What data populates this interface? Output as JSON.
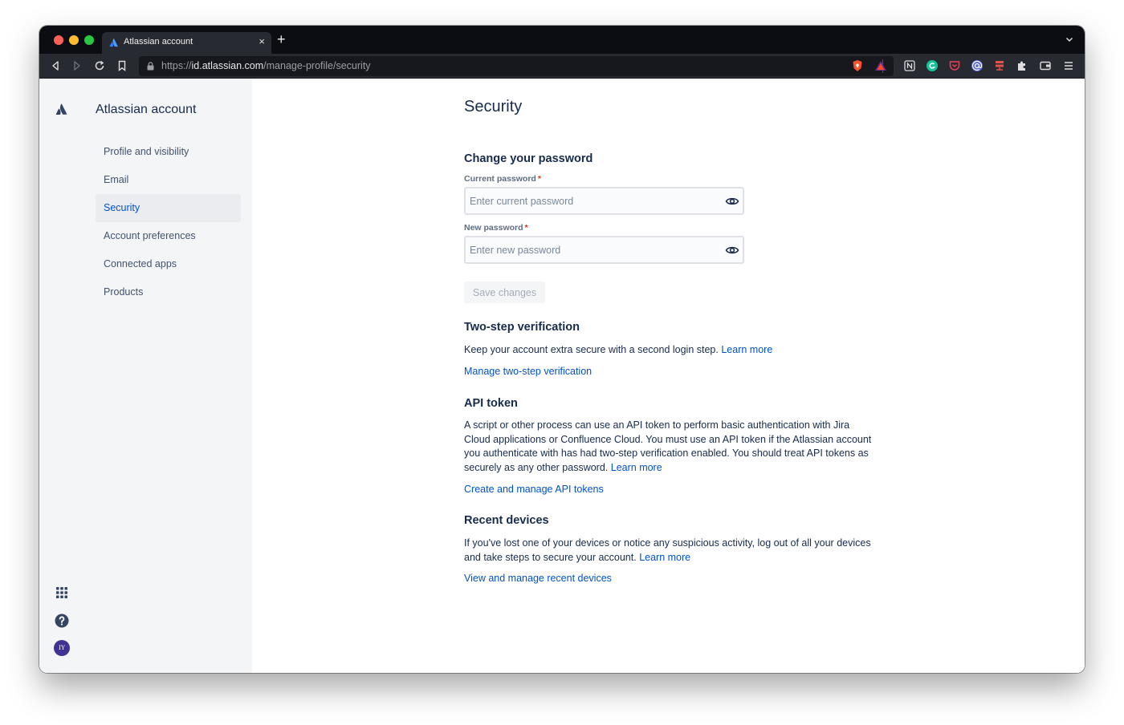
{
  "browser": {
    "tab_title": "Atlassian account",
    "tab_close": "×",
    "new_tab": "+",
    "url_scheme": "https://",
    "url_host": "id.atlassian.com",
    "url_path": "/manage-profile/security"
  },
  "sidebar": {
    "brand": "Atlassian account",
    "items": [
      {
        "label": "Profile and visibility"
      },
      {
        "label": "Email"
      },
      {
        "label": "Security",
        "active": true
      },
      {
        "label": "Account preferences"
      },
      {
        "label": "Connected apps"
      },
      {
        "label": "Products"
      }
    ],
    "avatar_initials": "IY"
  },
  "main": {
    "title": "Security",
    "password": {
      "heading": "Change your password",
      "current_label": "Current password",
      "current_placeholder": "Enter current password",
      "new_label": "New password",
      "new_placeholder": "Enter new password",
      "required_mark": "*",
      "save_label": "Save changes"
    },
    "two_step": {
      "heading": "Two-step verification",
      "text": "Keep your account extra secure with a second login step.",
      "learn_more": "Learn more",
      "action": "Manage two-step verification"
    },
    "api_token": {
      "heading": "API token",
      "text": "A script or other process can use an API token to perform basic authentication with Jira Cloud applications or Confluence Cloud. You must use an API token if the Atlassian account you authenticate with has had two-step verification enabled. You should treat API tokens as securely as any other password.",
      "learn_more": "Learn more",
      "action": "Create and manage API tokens"
    },
    "recent_devices": {
      "heading": "Recent devices",
      "text": "If you've lost one of your devices or notice any suspicious activity, log out of all your devices and take steps to secure your account.",
      "learn_more": "Learn more",
      "action": "View and manage recent devices"
    }
  },
  "colors": {
    "link": "#0052cc",
    "heading": "#172b4d",
    "sidebar_bg": "#f4f5f7",
    "required": "#de350b"
  }
}
